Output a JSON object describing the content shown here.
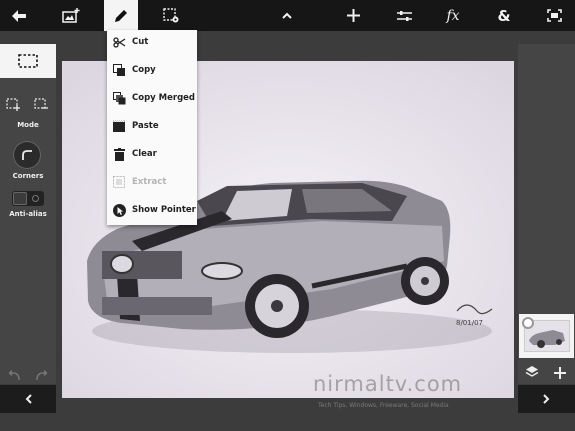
{
  "toolbar": {
    "icons": [
      "back-arrow-icon",
      "add-image-icon",
      "pencil-icon",
      "selection-settings-icon",
      "chevron-up-icon",
      "move-cross-icon",
      "adjustments-icon",
      "fx-icon",
      "ampersand-icon",
      "fullscreen-icon"
    ],
    "fx_label": "fx",
    "amp_label": "&"
  },
  "left_panel": {
    "mode_label": "Mode",
    "corners_label": "Corners",
    "antialias_label": "Anti-alias"
  },
  "edit_menu": {
    "items": [
      {
        "label": "Cut",
        "icon": "scissors-icon",
        "enabled": true
      },
      {
        "label": "Copy",
        "icon": "copy-icon",
        "enabled": true
      },
      {
        "label": "Copy Merged",
        "icon": "copy-merged-icon",
        "enabled": true
      },
      {
        "label": "Paste",
        "icon": "paste-icon",
        "enabled": true
      },
      {
        "label": "Clear",
        "icon": "trash-icon",
        "enabled": true
      },
      {
        "label": "Extract",
        "icon": "extract-icon",
        "enabled": false
      },
      {
        "label": "Show Pointer",
        "icon": "pointer-icon",
        "enabled": true
      }
    ]
  },
  "watermark": {
    "site": "nirmaltv.com",
    "tagline": "Tech Tips, Windows, Freeware, Social Media"
  },
  "colors": {
    "topbar": "#161616",
    "panel": "#454545",
    "menu": "#fafafa",
    "active": "#f4f4f4"
  }
}
